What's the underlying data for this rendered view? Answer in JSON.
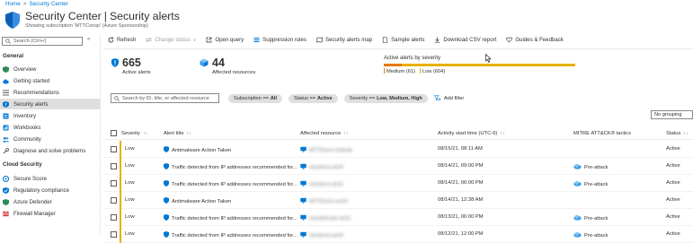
{
  "breadcrumb": {
    "home": "Home",
    "current": "Security Center"
  },
  "header": {
    "title_main": "Security Center",
    "title_sep": "|",
    "title_page": "Security alerts",
    "subtitle": "Showing subscription 'MTTConsp' (Azure Sponsorship)",
    "more": "···"
  },
  "sidebar": {
    "search_placeholder": "Search (Ctrl+/)",
    "collapse": "«",
    "sections": [
      {
        "title": "General",
        "items": [
          {
            "label": "Overview",
            "icon": "shield-icon"
          },
          {
            "label": "Getting started",
            "icon": "cloud-icon"
          },
          {
            "label": "Recommendations",
            "icon": "list-icon"
          },
          {
            "label": "Security alerts",
            "icon": "shield-alert-icon",
            "active": true
          },
          {
            "label": "Inventory",
            "icon": "inventory-icon"
          },
          {
            "label": "Workbooks",
            "icon": "workbook-icon"
          },
          {
            "label": "Community",
            "icon": "community-icon"
          },
          {
            "label": "Diagnose and solve problems",
            "icon": "wrench-icon"
          }
        ]
      },
      {
        "title": "Cloud Security",
        "items": [
          {
            "label": "Secure Score",
            "icon": "score-icon"
          },
          {
            "label": "Regulatory compliance",
            "icon": "compliance-icon"
          },
          {
            "label": "Azure Defender",
            "icon": "defender-icon"
          },
          {
            "label": "Firewall Manager",
            "icon": "firewall-icon"
          }
        ]
      }
    ]
  },
  "toolbar": {
    "refresh": "Refresh",
    "change_status": "Change status",
    "open_query": "Open query",
    "suppression_rules": "Suppression rules",
    "alerts_map": "Security alerts map",
    "sample_alerts": "Sample alerts",
    "download_csv": "Download CSV report",
    "guides": "Guides & Feedback"
  },
  "kpis": {
    "active_alerts": {
      "value": "665",
      "label": "Active alerts"
    },
    "affected_resources": {
      "value": "44",
      "label": "Affected resources"
    }
  },
  "severity": {
    "title": "Active alerts by severity",
    "medium_label": "Medium (61)",
    "low_label": "Low (604)",
    "medium_count": 61,
    "low_count": 604,
    "colors": {
      "medium": "#e87a00",
      "low": "#e8b000"
    }
  },
  "filters": {
    "search_placeholder": "Search by ID, title, or affected resource",
    "pills": [
      {
        "key": "Subscription == ",
        "value": "All"
      },
      {
        "key": "Status == ",
        "value": "Active"
      },
      {
        "key": "Severity == ",
        "value": "Low, Medium, High"
      }
    ],
    "add_filter": "Add filter",
    "grouping": "No grouping"
  },
  "table": {
    "columns": [
      "Severity",
      "Alert title",
      "Affected resource",
      "Activity start time (UTC-6)",
      "MITRE ATT&CK® tactics",
      "Status"
    ],
    "sort_glyph": "↑↓",
    "rows": [
      {
        "severity": "Low",
        "title": "Antimalware Action Taken",
        "resource": "MTTDemo-Gabrds",
        "time": "08/15/21, 08:11 AM",
        "tactic": "",
        "status": "Active"
      },
      {
        "severity": "Low",
        "title": "Traffic detected from IP addresses recommended for...",
        "resource": "mtcdemo-win9",
        "time": "08/14/21, 09:00 PM",
        "tactic": "Pre-attack",
        "status": "Active"
      },
      {
        "severity": "Low",
        "title": "Traffic detected from IP addresses recommended for...",
        "resource": "mtcdemo-dc01",
        "time": "08/14/21, 06:00 PM",
        "tactic": "Pre-attack",
        "status": "Active"
      },
      {
        "severity": "Low",
        "title": "Antimalware Action Taken",
        "resource": "MTTDemo-wvd4",
        "time": "08/14/21, 12:38 AM",
        "tactic": "",
        "status": "Active"
      },
      {
        "severity": "Low",
        "title": "Traffic detected from IP addresses recommended for...",
        "resource": "mtcdefender-dc01",
        "time": "08/13/21, 06:00 PM",
        "tactic": "Pre-attack",
        "status": "Active"
      },
      {
        "severity": "Low",
        "title": "Traffic detected from IP addresses recommended for...",
        "resource": "mtcdemo-win9",
        "time": "08/12/21, 12:00 PM",
        "tactic": "Pre-attack",
        "status": "Active"
      }
    ]
  }
}
